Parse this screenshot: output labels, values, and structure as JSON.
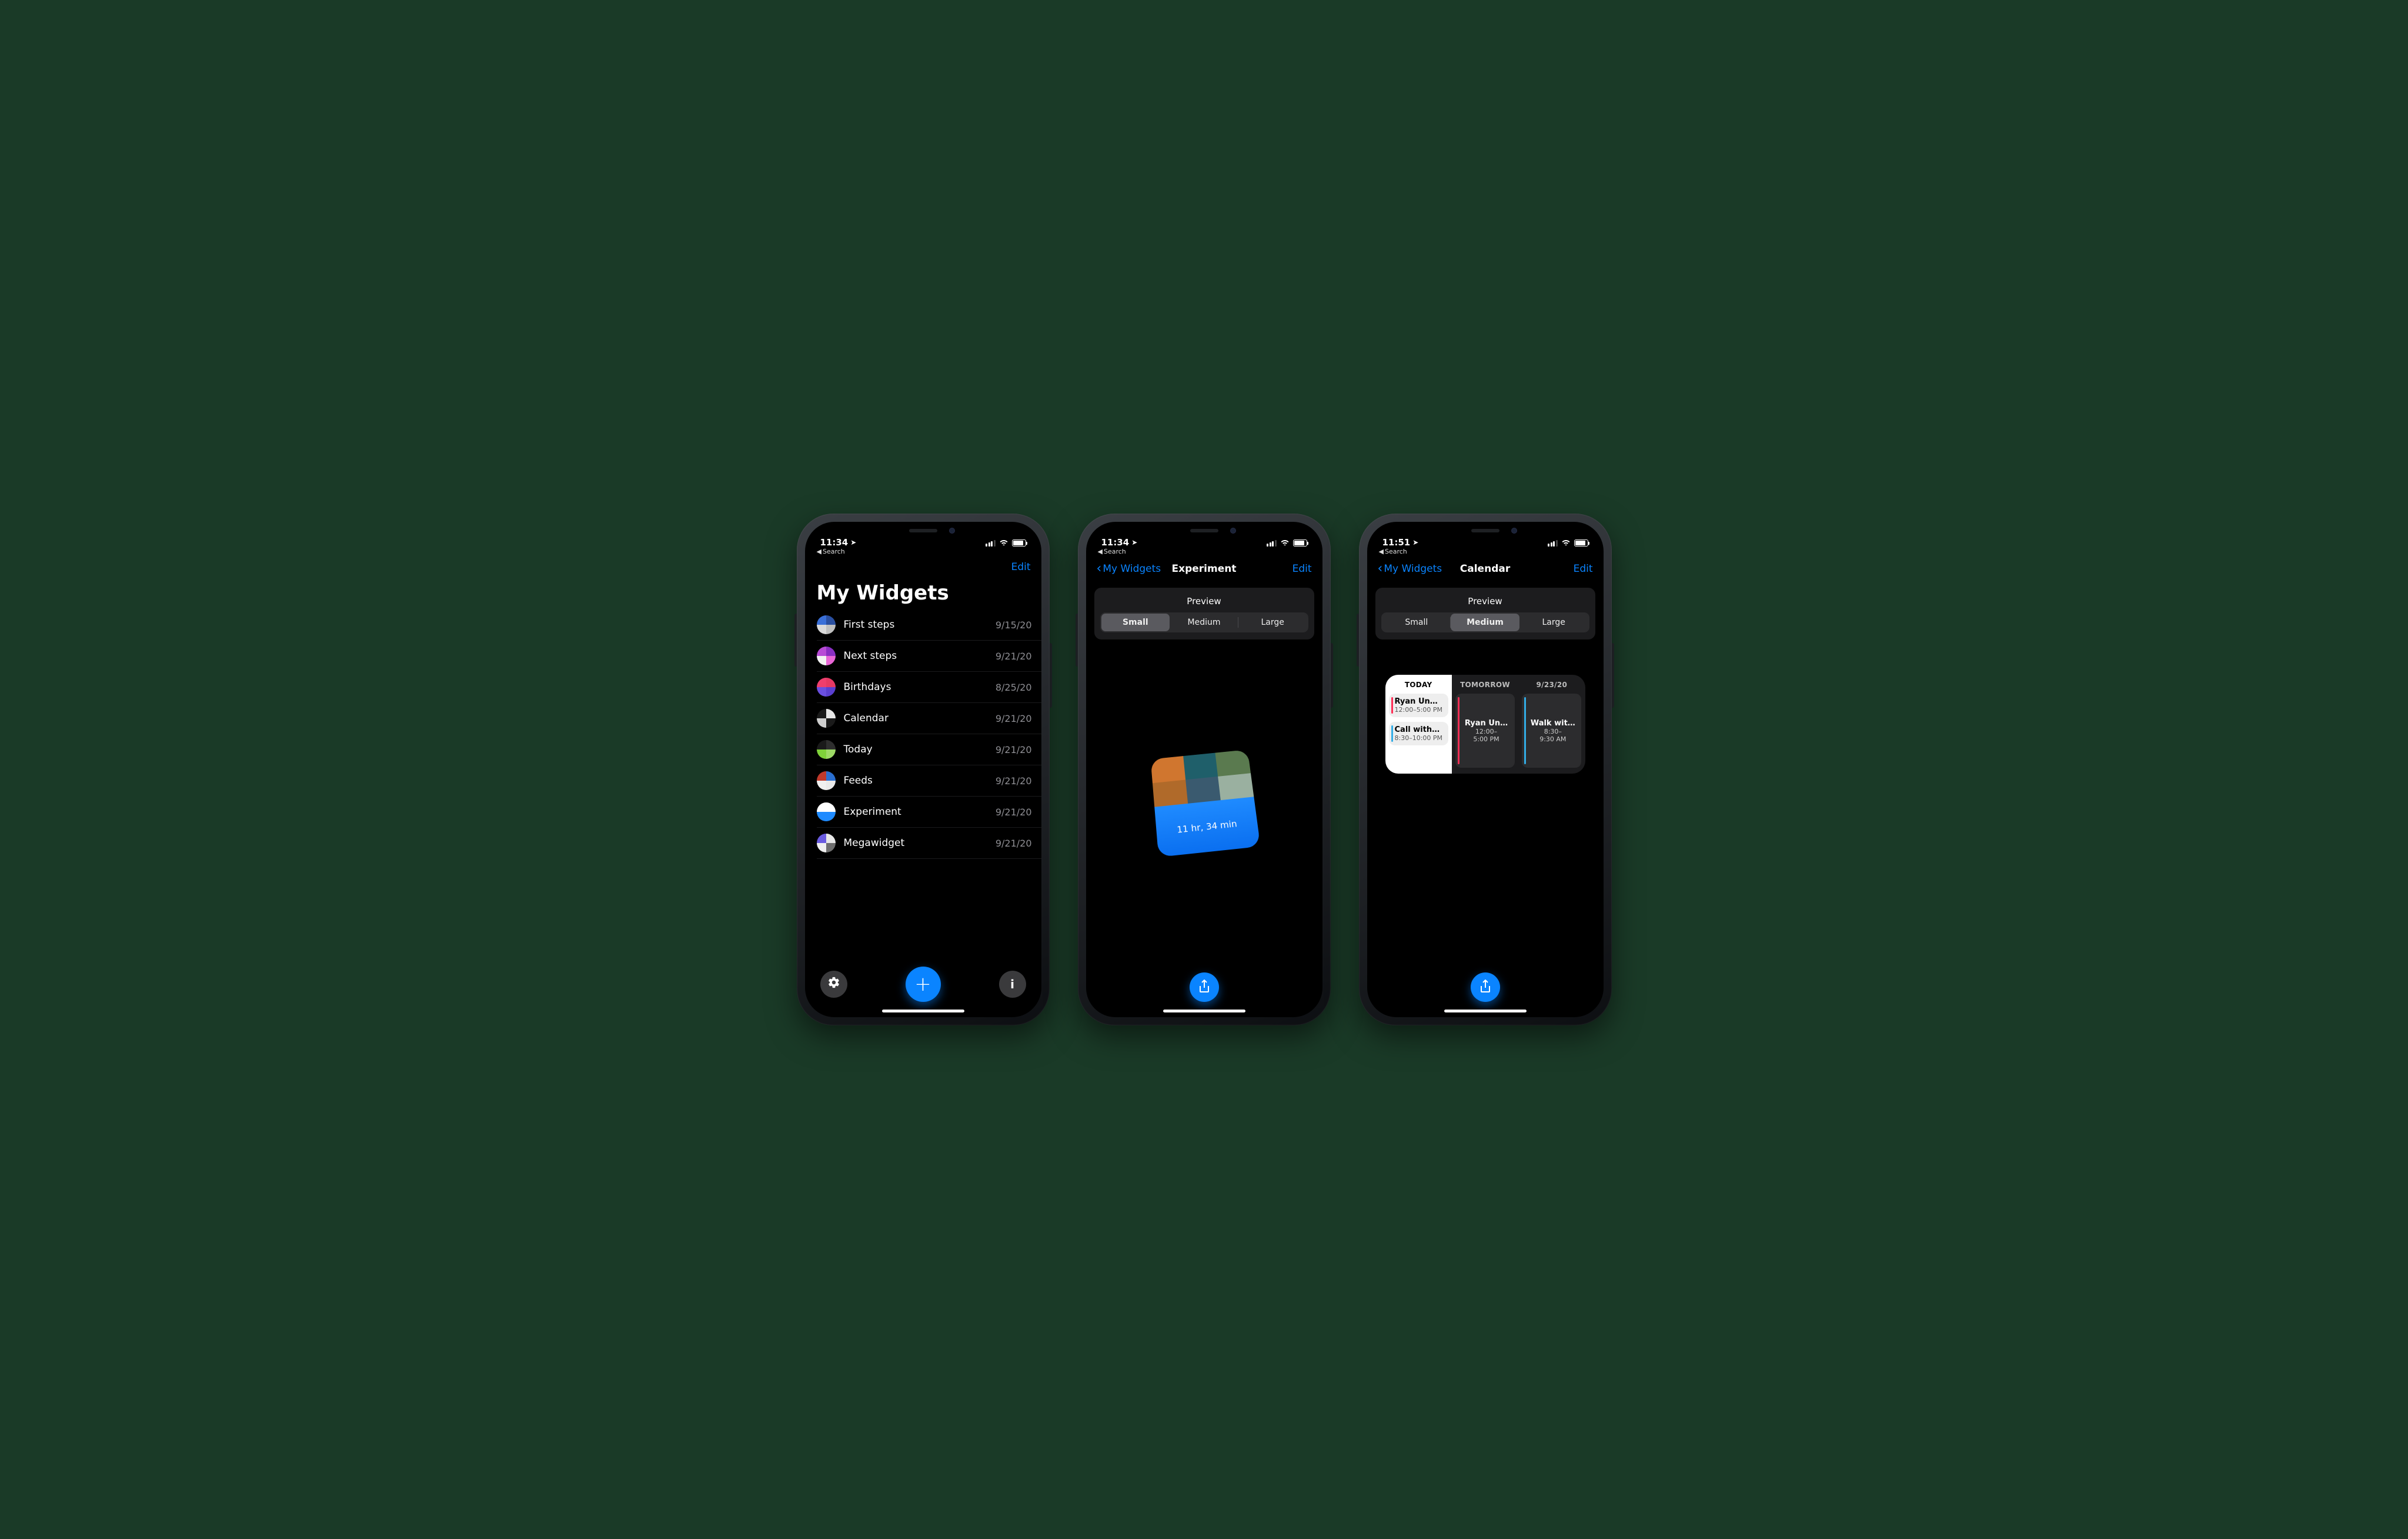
{
  "colors": {
    "blue": "#0a84ff",
    "green_bg": "#1a3a27",
    "pink": "#ff2d55",
    "cyan": "#32ade6"
  },
  "screens": [
    {
      "status": {
        "time": "11:34",
        "back_crumb": "Search"
      },
      "nav": {
        "edit": "Edit"
      },
      "title": "My Widgets",
      "items": [
        {
          "name": "First steps",
          "date": "9/15/20",
          "swatch": [
            "#3a6fd8",
            "#2a4fa0",
            "#d9d9d9",
            "#bfbfbf"
          ]
        },
        {
          "name": "Next steps",
          "date": "9/21/20",
          "swatch": [
            "#b84bd6",
            "#8a2fc2",
            "#f2f2f2",
            "#e966d6"
          ]
        },
        {
          "name": "Birthdays",
          "date": "8/25/20",
          "swatch": [
            "#ef3e6d",
            "#e63963",
            "#6a4fe0",
            "#5a3fd0"
          ]
        },
        {
          "name": "Calendar",
          "date": "9/21/20",
          "swatch": [
            "#1a1a1a",
            "#e6e6e6",
            "#cfcfcf",
            "#1a1a1a"
          ]
        },
        {
          "name": "Today",
          "date": "9/21/20",
          "swatch": [
            "#1a1a1a",
            "#2e2e2e",
            "#7fd23a",
            "#9edb66"
          ]
        },
        {
          "name": "Feeds",
          "date": "9/21/20",
          "swatch": [
            "#c0392b",
            "#2a6fd0",
            "#f0f0f0",
            "#eaeaea"
          ]
        },
        {
          "name": "Experiment",
          "date": "9/21/20",
          "swatch": [
            "#ffffff",
            "#ffffff",
            "#1f8bff",
            "#1f8bff"
          ]
        },
        {
          "name": "Megawidget",
          "date": "9/21/20",
          "swatch": [
            "#6a5be0",
            "#e8e8e8",
            "#efefef",
            "#6f6f6f"
          ]
        }
      ],
      "toolbar": {
        "settings": "gear",
        "add": "+",
        "info": "i"
      }
    },
    {
      "status": {
        "time": "11:34",
        "back_crumb": "Search"
      },
      "nav": {
        "back": "My Widgets",
        "title": "Experiment",
        "edit": "Edit"
      },
      "preview": {
        "header": "Preview",
        "sizes": [
          "Small",
          "Medium",
          "Large"
        ],
        "selected": 0
      },
      "widget": {
        "grid": [
          "#d0762f",
          "#1f5f6a",
          "#5a7a4f",
          "#b06a2a",
          "#3a5a6f",
          "#9ab0a0"
        ],
        "countdown": "11 hr, 34 min"
      },
      "share": "share"
    },
    {
      "status": {
        "time": "11:51",
        "back_crumb": "Search"
      },
      "nav": {
        "back": "My Widgets",
        "title": "Calendar",
        "edit": "Edit"
      },
      "preview": {
        "header": "Preview",
        "sizes": [
          "Small",
          "Medium",
          "Large"
        ],
        "selected": 1
      },
      "calendar": {
        "cols": [
          {
            "title": "TODAY",
            "events": [
              {
                "title": "Ryan Un…",
                "sub": "12:00–5:00 PM",
                "color": "#ff2d55"
              },
              {
                "title": "Call with…",
                "sub": "8:30–10:00 PM",
                "color": "#32ade6"
              }
            ]
          },
          {
            "title": "TOMORROW",
            "events": [
              {
                "title": "Ryan Un…",
                "sub": "12:00–\n5:00 PM",
                "color": "#ff2d55"
              }
            ]
          },
          {
            "title": "9/23/20",
            "events": [
              {
                "title": "Walk wit…",
                "sub": "8:30–\n9:30 AM",
                "color": "#32ade6"
              }
            ]
          }
        ]
      },
      "share": "share"
    }
  ]
}
